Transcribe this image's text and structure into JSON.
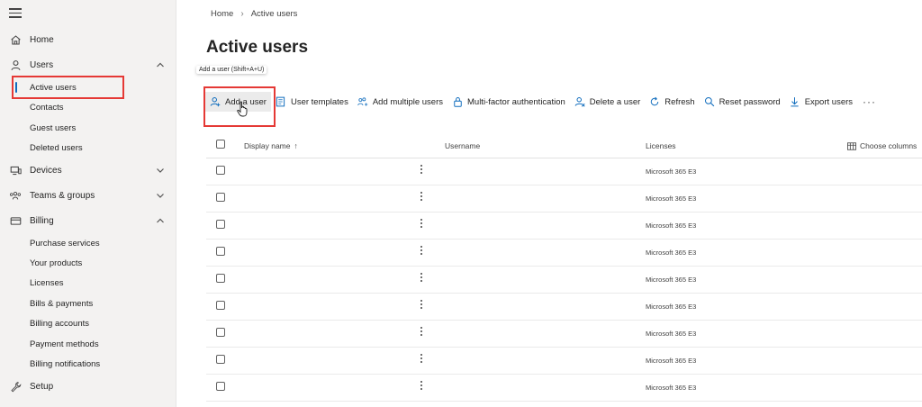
{
  "sidebar": {
    "nav": [
      {
        "label": "Home",
        "icon": "home-icon"
      },
      {
        "label": "Users",
        "icon": "user-icon",
        "expanded": true
      },
      {
        "label": "Devices",
        "icon": "devices-icon",
        "expanded": false
      },
      {
        "label": "Teams & groups",
        "icon": "teams-icon",
        "expanded": false
      },
      {
        "label": "Billing",
        "icon": "billing-icon",
        "expanded": true
      },
      {
        "label": "Setup",
        "icon": "wrench-icon"
      }
    ],
    "users_sub": [
      "Active users",
      "Contacts",
      "Guest users",
      "Deleted users"
    ],
    "billing_sub": [
      "Purchase services",
      "Your products",
      "Licenses",
      "Bills & payments",
      "Billing accounts",
      "Payment methods",
      "Billing notifications"
    ],
    "active_item": "Active users"
  },
  "breadcrumb": {
    "home": "Home",
    "current": "Active users"
  },
  "page": {
    "title": "Active users"
  },
  "tooltip": "Add a user (Shift+A+U)",
  "toolbar": {
    "add_user": "Add a user",
    "user_templates": "User templates",
    "add_multiple": "Add multiple users",
    "mfa": "Multi-factor authentication",
    "delete_user": "Delete a user",
    "refresh": "Refresh",
    "reset_password": "Reset password",
    "export_users": "Export users",
    "more": "···"
  },
  "table": {
    "columns": {
      "display_name": "Display name",
      "sort_arrow": "↑",
      "username": "Username",
      "licenses": "Licenses",
      "choose_columns": "Choose columns"
    },
    "rows": [
      {
        "license": "Microsoft 365 E3"
      },
      {
        "license": "Microsoft 365 E3"
      },
      {
        "license": "Microsoft 365 E3"
      },
      {
        "license": "Microsoft 365 E3"
      },
      {
        "license": "Microsoft 365 E3"
      },
      {
        "license": "Microsoft 365 E3"
      },
      {
        "license": "Microsoft 365 E3"
      },
      {
        "license": "Microsoft 365 E3"
      },
      {
        "license": "Microsoft 365 E3"
      }
    ]
  },
  "colors": {
    "accent": "#0f6cbd",
    "highlight_box": "#e53935",
    "sidebar_bg": "#f3f2f1"
  }
}
